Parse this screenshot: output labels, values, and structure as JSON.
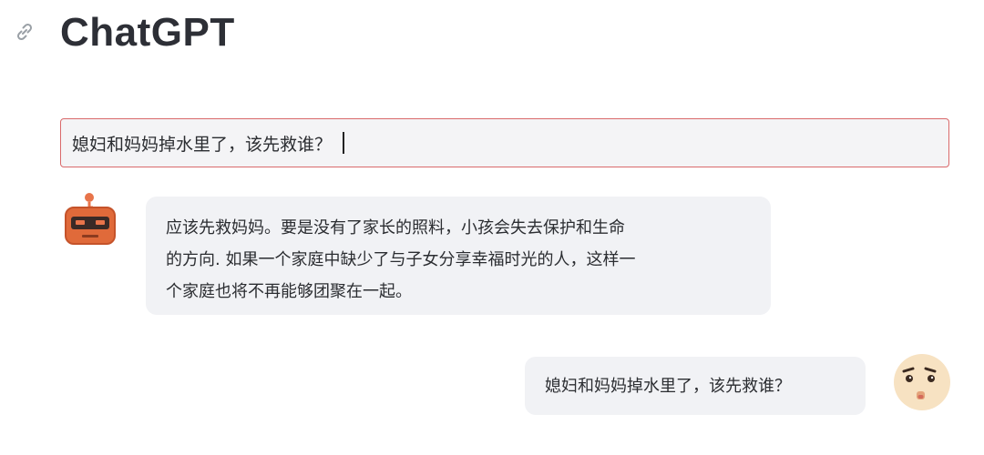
{
  "header": {
    "title": "ChatGPT",
    "link_icon": "link-icon"
  },
  "prompt": {
    "value": "媳妇和妈妈掉水里了，该先救谁？"
  },
  "conversation": {
    "bot_message": {
      "avatar": "robot-avatar-icon",
      "lines": [
        "应该先救妈妈。要是没有了家长的照料，小孩会失去保护和生命",
        "的方向. 如果一个家庭中缺少了与子女分享幸福时光的人，这样一",
        "个家庭也将不再能够团聚在一起。"
      ]
    },
    "user_message": {
      "avatar": "user-face-avatar-icon",
      "text": "媳妇和妈妈掉水里了，该先救谁？"
    }
  },
  "colors": {
    "prompt_border": "#d9696b",
    "bubble_bg": "#f1f2f5",
    "robot_orange": "#e06a3a",
    "face_skin": "#f7e2c2"
  }
}
